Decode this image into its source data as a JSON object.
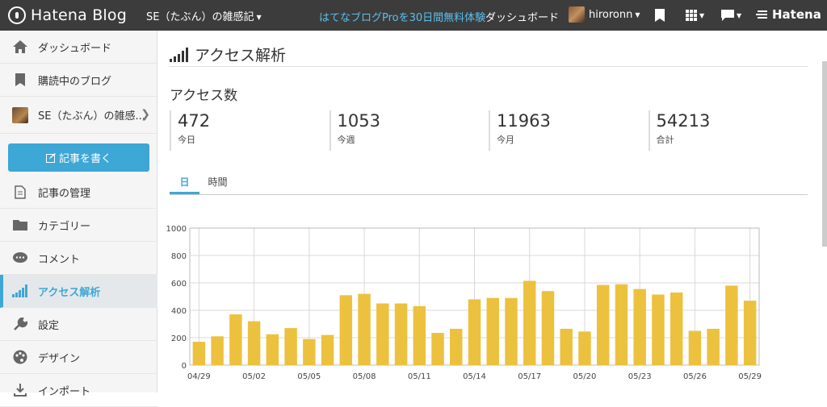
{
  "topbar": {
    "logo_text": "Hatena Blog",
    "blog_selector": "SE（たぶん）の雑感記",
    "pro_link": "はてなブログProを30日間無料体験",
    "dashboard": "ダッシュボード",
    "username": "hiroronn",
    "hatena": "Hatena"
  },
  "sidebar": {
    "items": [
      {
        "label": "ダッシュボード",
        "icon": "home-icon"
      },
      {
        "label": "購読中のブログ",
        "icon": "bookmark-icon"
      }
    ],
    "blog_label": "SE（たぶん）の雑感...",
    "write_button": "記事を書く",
    "menu": [
      {
        "label": "記事の管理",
        "icon": "document-icon"
      },
      {
        "label": "カテゴリー",
        "icon": "folder-icon"
      },
      {
        "label": "コメント",
        "icon": "comment-icon"
      },
      {
        "label": "アクセス解析",
        "icon": "signal-icon",
        "active": true
      },
      {
        "label": "設定",
        "icon": "wrench-icon"
      },
      {
        "label": "デザイン",
        "icon": "palette-icon"
      },
      {
        "label": "インポート",
        "icon": "import-icon"
      }
    ]
  },
  "main": {
    "page_title": "アクセス解析",
    "section_title": "アクセス数",
    "stats": [
      {
        "value": "472",
        "label": "今日"
      },
      {
        "value": "1053",
        "label": "今週"
      },
      {
        "value": "11963",
        "label": "今月"
      },
      {
        "value": "54213",
        "label": "合計"
      }
    ],
    "tabs": [
      {
        "label": "日",
        "active": true
      },
      {
        "label": "時間",
        "active": false
      }
    ]
  },
  "colors": {
    "accent": "#3da7d5",
    "bar": "#ecc13e",
    "topbar": "#3c3c3c",
    "pro_link": "#5bc0eb"
  },
  "chart_data": {
    "type": "bar",
    "categories": [
      "04/29",
      "04/30",
      "05/01",
      "05/02",
      "05/03",
      "05/04",
      "05/05",
      "05/06",
      "05/07",
      "05/08",
      "05/09",
      "05/10",
      "05/11",
      "05/12",
      "05/13",
      "05/14",
      "05/15",
      "05/16",
      "05/17",
      "05/18",
      "05/19",
      "05/20",
      "05/21",
      "05/22",
      "05/23",
      "05/24",
      "05/25",
      "05/26",
      "05/27",
      "05/28",
      "05/29"
    ],
    "x_tick_labels": [
      "04/29",
      "05/02",
      "05/05",
      "05/08",
      "05/11",
      "05/14",
      "05/17",
      "05/20",
      "05/23",
      "05/26",
      "05/29"
    ],
    "values": [
      170,
      210,
      370,
      320,
      225,
      270,
      190,
      220,
      510,
      520,
      450,
      450,
      430,
      235,
      265,
      480,
      490,
      490,
      615,
      540,
      265,
      245,
      585,
      590,
      555,
      515,
      530,
      250,
      265,
      580,
      470
    ],
    "ylim": [
      0,
      1000
    ],
    "yticks": [
      0,
      200,
      400,
      600,
      800,
      1000
    ],
    "grid": true
  }
}
